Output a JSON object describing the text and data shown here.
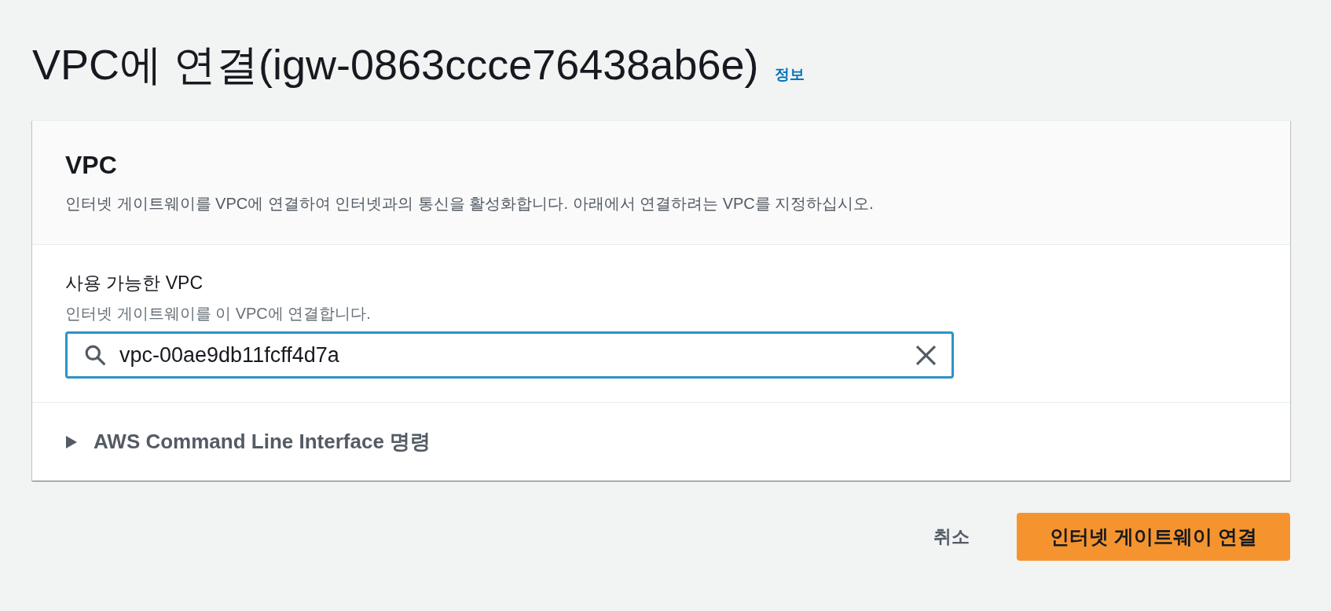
{
  "page": {
    "title": "VPC에 연결(igw-0863ccce76438ab6e)",
    "info_link": "정보"
  },
  "panel": {
    "header": {
      "title": "VPC",
      "description": "인터넷 게이트웨이를 VPC에 연결하여 인터넷과의 통신을 활성화합니다. 아래에서 연결하려는 VPC를 지정하십시오."
    },
    "field": {
      "label": "사용 가능한 VPC",
      "description": "인터넷 게이트웨이를 이 VPC에 연결합니다.",
      "value": "vpc-00ae9db11fcff4d7a",
      "focused": true
    },
    "expandable": {
      "label": "AWS Command Line Interface 명령",
      "expanded": false
    }
  },
  "buttons": [
    {
      "label": "취소",
      "kind": "link"
    },
    {
      "label": "인터넷 게이트웨이 연결",
      "kind": "primary"
    }
  ]
}
